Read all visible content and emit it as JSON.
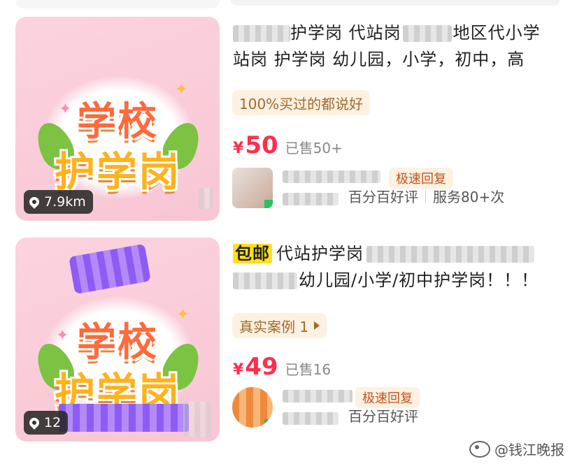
{
  "listings": [
    {
      "distance": "7.9km",
      "thumb_line1": "学校",
      "thumb_line2": "护学岗",
      "title_line1": "护学岗 代站岗",
      "title_line1_tail": "地区代小学",
      "title_line2": "站岗 护学岗  幼儿园，小学，初中，高",
      "tag": "100%买过的都说好",
      "currency": "¥",
      "price": "50",
      "sold": "已售50+",
      "fast_reply": "极速回复",
      "rating": "百分百好评",
      "service": "服务80+次"
    },
    {
      "distance": "12",
      "thumb_line1": "学校",
      "thumb_line2": "护学岗",
      "free_shipping": "包邮",
      "title_line1": "代站护学岗",
      "title_line2": "幼儿园/小学/初中护学岗！！！",
      "tag": "真实案例 1",
      "currency": "¥",
      "price": "49",
      "sold": "已售16",
      "fast_reply": "极速回复",
      "rating": "百分百好评"
    }
  ],
  "watermark": "@钱江晚报",
  "colors": {
    "price": "#ff2e4d",
    "tag_bg": "#fdf1e1",
    "tag_text": "#a06a2e",
    "free_bg": "#ffe01a"
  },
  "icons": [
    "location-pin-icon",
    "play-triangle-icon",
    "weibo-logo-icon"
  ]
}
